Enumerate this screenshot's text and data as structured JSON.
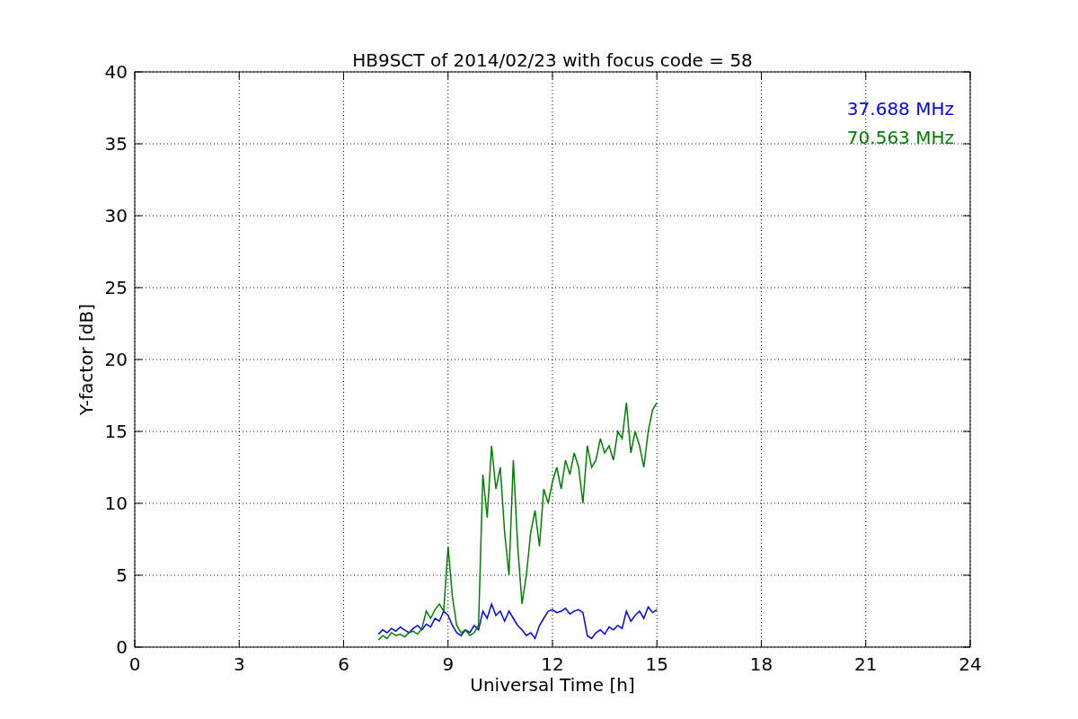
{
  "figure": {
    "chart_data": {
      "type": "line",
      "title": "HB9SCT of 2014/02/23 with focus code = 58",
      "xlabel": "Universal Time [h]",
      "ylabel": "Y-factor [dB]",
      "x": [
        7,
        7.125,
        7.25,
        7.375,
        7.5,
        7.625,
        7.75,
        7.875,
        8,
        8.125,
        8.25,
        8.375,
        8.5,
        8.625,
        8.75,
        8.875,
        9,
        9.125,
        9.25,
        9.375,
        9.5,
        9.625,
        9.75,
        9.875,
        10,
        10.125,
        10.25,
        10.375,
        10.5,
        10.625,
        10.75,
        10.875,
        11,
        11.125,
        11.25,
        11.375,
        11.5,
        11.625,
        11.75,
        11.875,
        12,
        12.125,
        12.25,
        12.375,
        12.5,
        12.625,
        12.75,
        12.875,
        13,
        13.125,
        13.25,
        13.375,
        13.5,
        13.625,
        13.75,
        13.875,
        14,
        14.125,
        14.25,
        14.375,
        14.5,
        14.625,
        14.75,
        14.875,
        15
      ],
      "series": [
        {
          "name": "37.688 MHz",
          "color": "#0000ff",
          "values": [
            0.9,
            1.2,
            1.0,
            1.3,
            1.1,
            1.4,
            1.2,
            1.0,
            1.3,
            1.5,
            1.2,
            1.6,
            1.4,
            2.0,
            1.8,
            2.5,
            2.2,
            1.5,
            1.0,
            0.8,
            1.2,
            1.0,
            1.5,
            1.2,
            2.5,
            2.0,
            3.0,
            2.2,
            2.5,
            1.8,
            2.5,
            2.0,
            1.5,
            1.2,
            0.8,
            1.0,
            0.6,
            1.5,
            2.0,
            2.5,
            2.6,
            2.4,
            2.5,
            2.7,
            2.3,
            2.5,
            2.6,
            2.4,
            0.8,
            0.6,
            1.0,
            1.2,
            0.9,
            1.4,
            1.2,
            1.5,
            1.3,
            2.5,
            1.8,
            2.2,
            2.5,
            2.0,
            2.8,
            2.4,
            2.6
          ]
        },
        {
          "name": "70.563 MHz",
          "color": "#008000",
          "values": [
            0.5,
            0.8,
            0.6,
            1.0,
            0.8,
            0.9,
            0.7,
            1.0,
            1.1,
            0.9,
            1.3,
            2.5,
            2.0,
            2.6,
            3.0,
            2.5,
            7.0,
            3.5,
            1.5,
            1.0,
            1.2,
            0.8,
            1.0,
            1.5,
            12.0,
            9.0,
            14.0,
            11.0,
            12.5,
            8.0,
            5.0,
            13.0,
            7.0,
            3.0,
            5.0,
            8.0,
            9.5,
            7.0,
            11.0,
            10.0,
            11.5,
            12.5,
            11.0,
            13.0,
            12.0,
            13.5,
            12.5,
            10.0,
            14.0,
            12.5,
            13.0,
            14.5,
            13.5,
            14.0,
            13.0,
            15.0,
            14.5,
            17.0,
            13.5,
            15.0,
            14.0,
            12.5,
            15.0,
            16.5,
            17.0
          ]
        }
      ],
      "grid": true,
      "xlim": [
        0,
        24
      ],
      "ylim": [
        0,
        40
      ],
      "xticks": [
        0,
        3,
        6,
        9,
        12,
        15,
        18,
        21,
        24
      ],
      "yticks": [
        0,
        5,
        10,
        15,
        20,
        25,
        30,
        35,
        40
      ]
    }
  }
}
